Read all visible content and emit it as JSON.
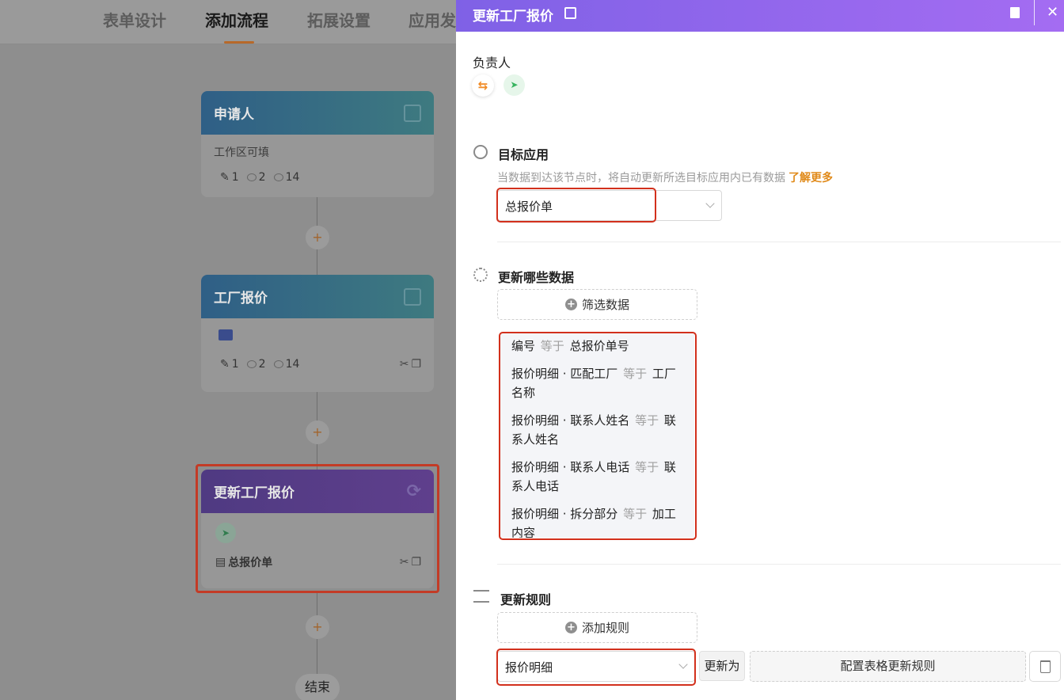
{
  "topnav": {
    "tabs": [
      "表单设计",
      "添加流程",
      "拓展设置",
      "应用发"
    ],
    "active_index": 1
  },
  "workflow": {
    "nodes": [
      {
        "title": "申请人",
        "body_text": "工作区可填",
        "stats": {
          "edit": "1",
          "view": "2",
          "watch": "14"
        }
      },
      {
        "title": "工厂报价",
        "stats": {
          "edit": "1",
          "view": "2",
          "watch": "14"
        }
      },
      {
        "title": "更新工厂报价",
        "target": "总报价单"
      }
    ],
    "add_symbol": "+",
    "end_label": "结束"
  },
  "drawer": {
    "title": "更新工厂报价",
    "owner_label": "负责人",
    "target_app": {
      "title": "目标应用",
      "hint": "当数据到达该节点时，将自动更新所选目标应用内已有数据",
      "learn_more": "了解更多",
      "selected": "总报价单"
    },
    "update_data": {
      "title": "更新哪些数据",
      "filter_button": "筛选数据",
      "conditions": [
        {
          "field": "编号",
          "op": "等于",
          "value": "总报价单号"
        },
        {
          "field": "报价明细 · 匹配工厂",
          "op": "等于",
          "value": "工厂名称"
        },
        {
          "field": "报价明细 · 联系人姓名",
          "op": "等于",
          "value": "联系人姓名"
        },
        {
          "field": "报价明细 · 联系人电话",
          "op": "等于",
          "value": "联系人电话"
        },
        {
          "field": "报价明细 · 拆分部分",
          "op": "等于",
          "value": "加工内容"
        }
      ]
    },
    "update_rules": {
      "title": "更新规则",
      "add_button": "添加规则",
      "rule": {
        "field": "报价明细",
        "action_label": "更新为",
        "config_button": "配置表格更新规则"
      }
    }
  },
  "colors": {
    "header_gradient_start": "#7f61e6",
    "header_gradient_end": "#a46cf2",
    "accent_orange": "#e08a1a",
    "annotation_red": "#d2301c"
  }
}
